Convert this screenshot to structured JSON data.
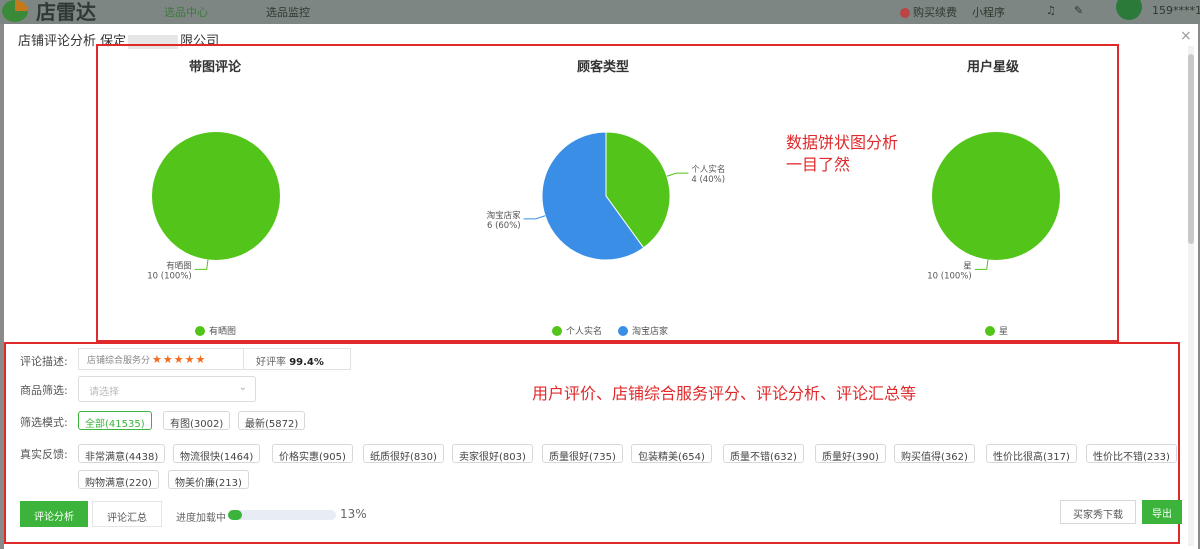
{
  "app": {
    "name": "店雷达",
    "tabs": [
      "选品中心",
      "选品监控"
    ],
    "top_right": [
      "购买续费",
      "小程序"
    ],
    "phone": "159****1"
  },
  "modal": {
    "title_prefix": "店铺评论分析",
    "title_store_a": "保定",
    "title_store_b": "限公司",
    "close": "×"
  },
  "charts": {
    "callout_line1": "数据饼状图分析",
    "callout_line2": "一目了然",
    "pies": [
      {
        "title": "带图评论",
        "slices": [
          {
            "label": "有晒图",
            "value": 10,
            "pct": "100%",
            "color": "#52c41a"
          }
        ]
      },
      {
        "title": "顾客类型",
        "slices": [
          {
            "label": "个人实名",
            "value": 4,
            "pct": "40%",
            "color": "#52c41a"
          },
          {
            "label": "淘宝店家",
            "value": 6,
            "pct": "60%",
            "color": "#3a8ee6"
          }
        ]
      },
      {
        "title": "用户星级",
        "slices": [
          {
            "label": "星",
            "value": 10,
            "pct": "100%",
            "color": "#52c41a"
          }
        ]
      }
    ]
  },
  "filters": {
    "desc_label": "评论描述:",
    "service_label": "店铺综合服务分",
    "stars": "★★★★★",
    "good_rate_label": "好评率",
    "good_rate_value": "99.4%",
    "goods_label": "商品筛选:",
    "goods_placeholder": "请选择",
    "mode_label": "筛选模式:",
    "modes": [
      "全部(41535)",
      "有图(3002)",
      "最新(5872)"
    ],
    "feedback_label": "真实反馈:",
    "feedback_tags": [
      "非常满意(4438)",
      "物流很快(1464)",
      "价格实惠(905)",
      "纸质很好(830)",
      "卖家很好(803)",
      "质量很好(735)",
      "包装精美(654)",
      "质量不错(632)",
      "质量好(390)",
      "购买值得(362)",
      "性价比很高(317)",
      "性价比不错(233)",
      "购物满意(220)",
      "物美价廉(213)"
    ],
    "callout": "用户评价、店铺综合服务评分、评论分析、评论汇总等"
  },
  "bottom": {
    "tab_analysis": "评论分析",
    "tab_summary": "评论汇总",
    "progress_label": "进度加载中",
    "progress": 0.13,
    "progress_text": "13%",
    "buyer_download": "买家秀下载",
    "export": "导出"
  }
}
